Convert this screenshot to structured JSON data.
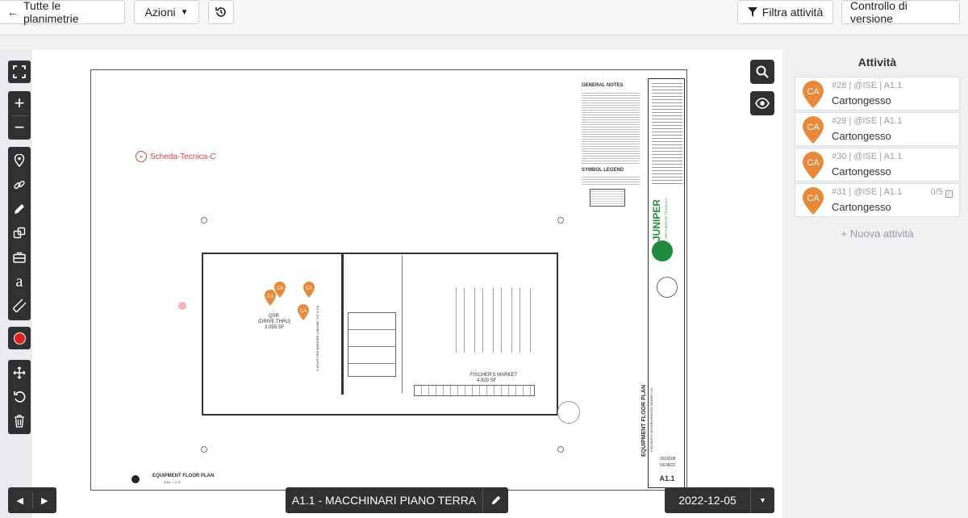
{
  "toolbar": {
    "back_label": "Tutte le planimetrie",
    "actions_label": "Azioni",
    "filter_label": "Filtra attività",
    "version_label": "Controllo di versione"
  },
  "viewer": {
    "sheet_title": "A1.1 - MACCHINARI PIANO TERRA",
    "date_value": "2022-12-05",
    "link_label": "Scheda-Tecnica-C"
  },
  "plan": {
    "general_notes_title": "GENERAL NOTES",
    "symbol_legend_title": "SYMBOL LEGEND",
    "room_qsr_name": "QSR",
    "room_qsr_sub": "(DRIVE THRU)",
    "room_qsr_area": "3,055 SF",
    "room_market_name": "FISCHER'S MARKET",
    "room_market_area": "4,920 SF",
    "drawing_title": "EQUIPMENT FLOOR PLAN",
    "drawing_scale": "3/16\" = 1'-0\"",
    "brand": "JUNIPER",
    "brand_sub": "VENTURES OF TEXAS LLC",
    "titleblock_title": "EQUIPMENT FLOOR PLAN",
    "titleblock_project": "FISCHER'S NEIGHBORHOOD MARKET #5",
    "project_no": "2019108",
    "issue_date": "03/28/22",
    "sheet_no": "A1.1",
    "pin_label": "CA",
    "wall_note": "3-HOUR FIRE BARRIER (UBC/IBC 707.3.10)"
  },
  "panel": {
    "title": "Attività",
    "new_label": "+ Nuova attività",
    "items": [
      {
        "meta": "#28 | @ISE | A1.1",
        "name": "Cartongesso",
        "avatar": "CA",
        "extra": ""
      },
      {
        "meta": "#29 | @ISE | A1.1",
        "name": "Cartongesso",
        "avatar": "CA",
        "extra": ""
      },
      {
        "meta": "#30 | @ISE | A1.1",
        "name": "Cartongesso",
        "avatar": "CA",
        "extra": ""
      },
      {
        "meta": "#31 | @ISE | A1.1",
        "name": "Cartongesso",
        "avatar": "CA",
        "extra": "0/5"
      }
    ]
  },
  "colors": {
    "pin": "#e8893a",
    "toolbar_dark": "#2f3133",
    "record": "#e02020"
  },
  "icons": {
    "back": "arrow-left-icon",
    "dropdown": "caret-down-icon",
    "history": "history-icon",
    "filter": "filter-icon",
    "search": "search-icon",
    "eye": "eye-icon"
  }
}
